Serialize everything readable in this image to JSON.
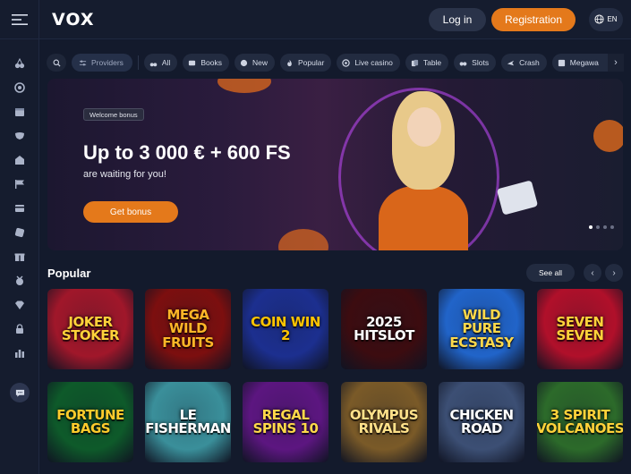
{
  "header": {
    "logo": "VOX",
    "login_label": "Log in",
    "registration_label": "Registration",
    "language": "EN"
  },
  "filters": {
    "providers_label": "Providers",
    "categories": [
      "All",
      "Books",
      "New",
      "Popular",
      "Live casino",
      "Table",
      "Slots",
      "Crash",
      "Megawa"
    ]
  },
  "banner": {
    "badge": "Welcome bonus",
    "headline": "Up to 3 000 € + 600 FS",
    "subline": "are waiting for you!",
    "cta": "Get bonus"
  },
  "popular": {
    "title": "Popular",
    "see_all": "See all",
    "games": [
      {
        "name": "JOKER STOKER",
        "bg": "#a0172a",
        "fg": "#ffd23a"
      },
      {
        "name": "MEGA WILD FRUITS",
        "bg": "#7c0f0f",
        "fg": "#ffb627"
      },
      {
        "name": "COIN WIN 2",
        "bg": "#1c2f8f",
        "fg": "#ffc400"
      },
      {
        "name": "2025 HITSLOT",
        "bg": "#3c0c10",
        "fg": "#ffffff"
      },
      {
        "name": "WILD PURE ECSTASY",
        "bg": "#2164c9",
        "fg": "#ffd84a"
      },
      {
        "name": "SEVEN SEVEN",
        "bg": "#b0102a",
        "fg": "#ffd23a"
      },
      {
        "name": "FORTUNE BAGS",
        "bg": "#0e5a2a",
        "fg": "#ffcb2c"
      },
      {
        "name": "LE FISHERMAN",
        "bg": "#3a8f9a",
        "fg": "#ffffff"
      },
      {
        "name": "REGAL SPINS 10",
        "bg": "#5c1680",
        "fg": "#ffd84a"
      },
      {
        "name": "OLYMPUS RIVALS",
        "bg": "#7a5a28",
        "fg": "#ffe18a"
      },
      {
        "name": "CHICKEN ROAD",
        "bg": "#3c4f74",
        "fg": "#ffffff"
      },
      {
        "name": "3 SPIRIT VOLCANOES",
        "bg": "#2c6a2a",
        "fg": "#ffd23a"
      }
    ]
  },
  "colors": {
    "accent": "#e4791b",
    "background": "#131a2c",
    "chip": "#222b40"
  }
}
